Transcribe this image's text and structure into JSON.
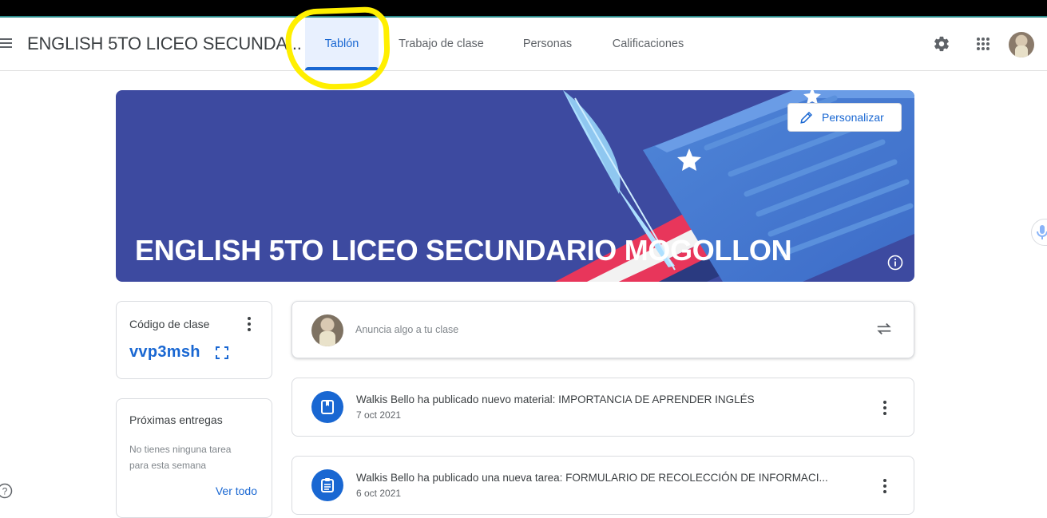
{
  "header": {
    "class_title": "ENGLISH 5TO LICEO SECUNDA...",
    "tabs": [
      {
        "label": "Tablón",
        "active": true
      },
      {
        "label": "Trabajo de clase",
        "active": false
      },
      {
        "label": "Personas",
        "active": false
      },
      {
        "label": "Calificaciones",
        "active": false
      }
    ],
    "icons": [
      "menu-icon",
      "gear-icon",
      "apps-grid-icon",
      "avatar"
    ]
  },
  "banner": {
    "title": "ENGLISH 5TO LICEO SECUNDARIO MOGOLLON",
    "customize_label": "Personalizar",
    "background_color": "#3d4aa0"
  },
  "class_code": {
    "label": "Código de clase",
    "value": "vvp3msh"
  },
  "upcoming": {
    "title": "Próximas entregas",
    "text": "No tienes ninguna tarea para esta semana",
    "link": "Ver todo"
  },
  "announce": {
    "placeholder": "Anuncia algo a tu clase"
  },
  "posts": [
    {
      "title": "Walkis Bello ha publicado nuevo material: IMPORTANCIA DE APRENDER INGLÉS",
      "date": "7 oct 2021",
      "icon": "material-book-icon"
    },
    {
      "title": "Walkis Bello ha publicado una nueva tarea: FORMULARIO DE RECOLECCIÓN DE INFORMACI...",
      "date": "6 oct 2021",
      "icon": "assignment-icon"
    }
  ],
  "colors": {
    "accent": "#1967d2",
    "highlight": "#ffef00"
  }
}
